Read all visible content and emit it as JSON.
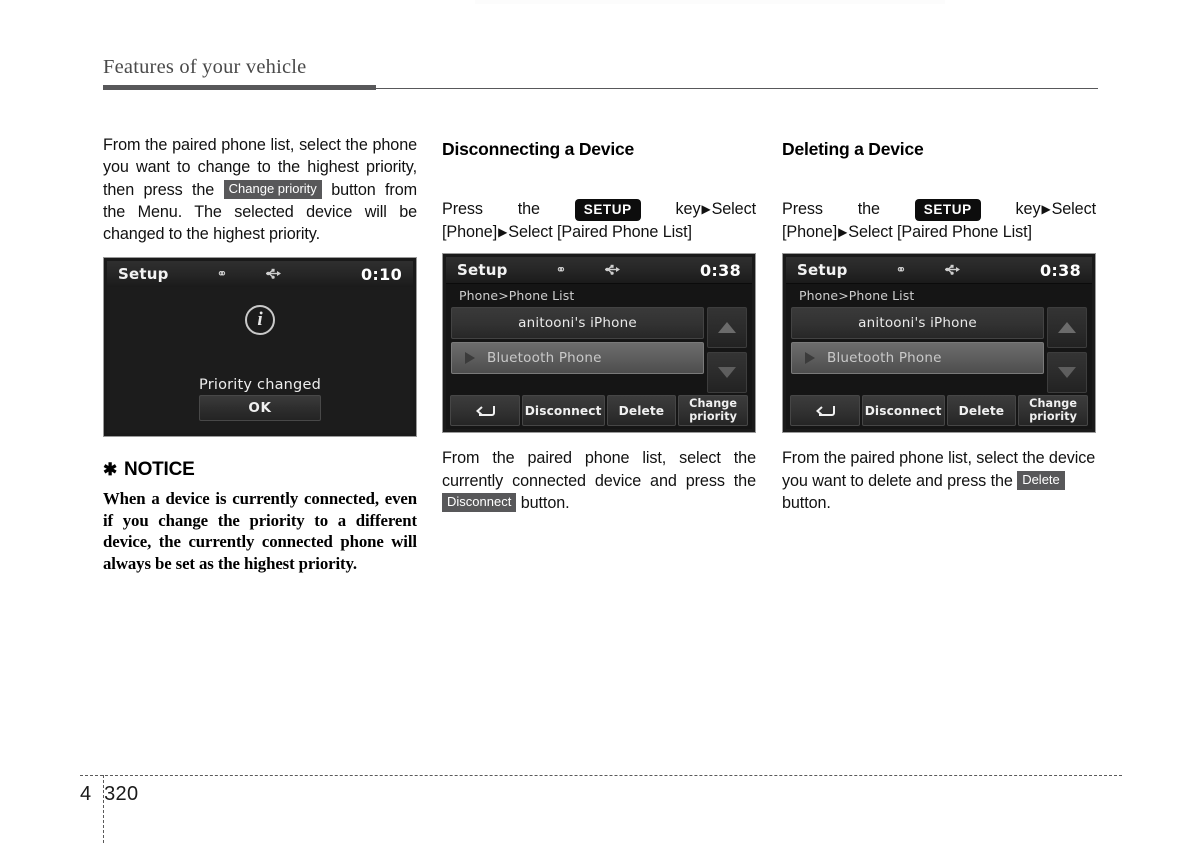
{
  "header": {
    "title": "Features of your vehicle"
  },
  "footer": {
    "chapter": "4",
    "page": "320"
  },
  "columns": {
    "left": {
      "intro_part1": "From the paired phone list, select the phone you want to change to the highest priority, then press the",
      "inline_button": "Change priority",
      "intro_part2": "button from the Menu. The selected device will be changed to the highest priority.",
      "screen": {
        "status_title": "Setup",
        "bluetooth_icon": "bluetooth-icon",
        "usb_icon": "usb-icon",
        "time": "0:10",
        "info_icon": "info-icon",
        "message": "Priority changed",
        "ok_label": "OK"
      },
      "notice": {
        "star": "✱",
        "heading": "NOTICE",
        "body": "When a device is currently connected, even if you change the priority to a different device, the currently connected phone will always be set as the highest priority."
      }
    },
    "middle": {
      "heading": "Disconnecting a Device",
      "path_press": "Press",
      "path_the": "the",
      "key_badge": "SETUP",
      "path_key": "key",
      "path_select1": "Select [Phone]",
      "path_select2": "Select [Paired Phone List]",
      "screen": {
        "status_title": "Setup",
        "bluetooth_icon": "bluetooth-icon",
        "usb_icon": "usb-icon",
        "time": "0:38",
        "breadcrumb": "Phone>Phone List",
        "rows": [
          {
            "label": "anitooni's iPhone",
            "selected": false
          },
          {
            "label": "Bluetooth Phone",
            "selected": true
          }
        ],
        "scroll_up": "scroll-up-icon",
        "scroll_down": "scroll-down-icon",
        "buttons": [
          {
            "label": "",
            "icon": "back-arrow-icon"
          },
          {
            "label": "Disconnect",
            "icon": ""
          },
          {
            "label": "Delete",
            "icon": ""
          },
          {
            "label": "Change priority",
            "icon": ""
          }
        ]
      },
      "caption_part1": "From the paired phone list, select the currently connected device and press the",
      "caption_button": "Disconnect",
      "caption_part2": "button."
    },
    "right": {
      "heading": "Deleting a Device",
      "path_press": "Press",
      "path_the": "the",
      "key_badge": "SETUP",
      "path_key": "key",
      "path_select1": "Select [Phone]",
      "path_select2": "Select [Paired Phone List]",
      "screen": {
        "status_title": "Setup",
        "bluetooth_icon": "bluetooth-icon",
        "usb_icon": "usb-icon",
        "time": "0:38",
        "breadcrumb": "Phone>Phone List",
        "rows": [
          {
            "label": "anitooni's iPhone",
            "selected": false
          },
          {
            "label": "Bluetooth Phone",
            "selected": true
          }
        ],
        "scroll_up": "scroll-up-icon",
        "scroll_down": "scroll-down-icon",
        "buttons": [
          {
            "label": "",
            "icon": "back-arrow-icon"
          },
          {
            "label": "Disconnect",
            "icon": ""
          },
          {
            "label": "Delete",
            "icon": ""
          },
          {
            "label": "Change priority",
            "icon": ""
          }
        ]
      },
      "caption_part1": "From the paired phone list, select the device you want to delete and press the",
      "caption_button": "Delete",
      "caption_part2": "button."
    }
  },
  "colors": {
    "rule": "#58585a",
    "screen_bg": "#1a1a1a",
    "badge_dark": "#58585a",
    "badge_key": "#0d0d0d"
  }
}
